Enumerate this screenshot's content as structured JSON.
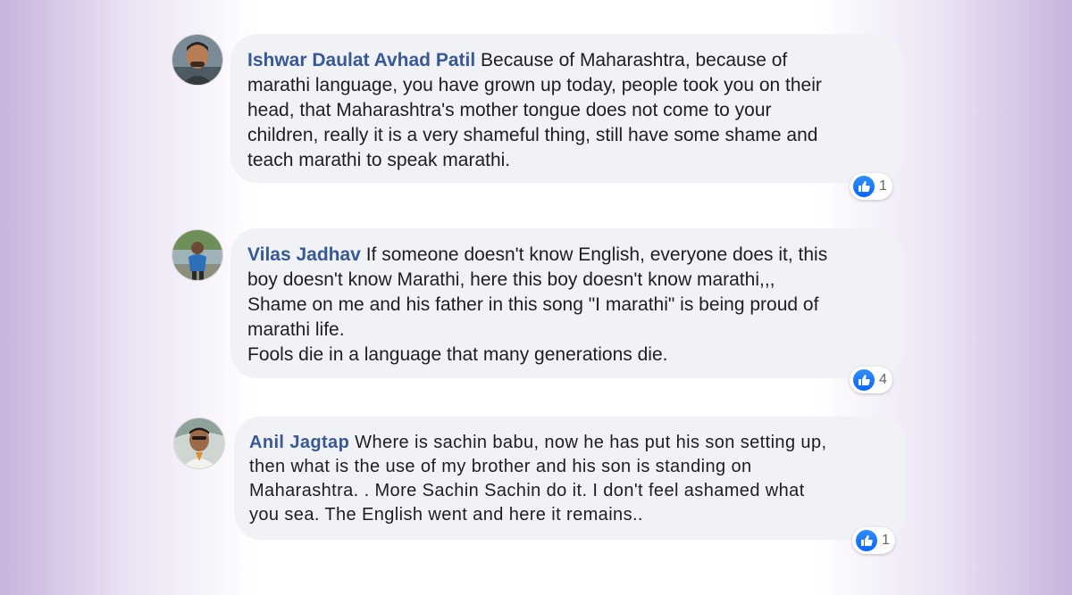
{
  "colors": {
    "author": "#385898",
    "bubble": "#f0f2f5",
    "text": "#1c1e21",
    "like": "#0866ff",
    "count": "#65676b",
    "side_glow": "#c7b3dd"
  },
  "comments": [
    {
      "author": "Ishwar Daulat Avhad Patil",
      "text": "Because of Maharashtra, because of\nmarathi language, you have grown up today, people took you on their\nhead, that Maharashtra's mother tongue does not come to your\nchildren, really it is a very shameful thing, still have some shame and\nteach marathi to speak marathi.",
      "reaction_icon": "like-icon",
      "reaction_count": "1"
    },
    {
      "author": "Vilas Jadhav",
      "text": "If someone doesn't know English, everyone does it, this\nboy doesn't know Marathi, here this boy doesn't know marathi,,,\nShame on me and his father in this song \"I marathi\" is being proud of\nmarathi life.\nFools die in a language that many generations die.",
      "reaction_icon": "like-icon",
      "reaction_count": "4"
    },
    {
      "author": "Anil Jagtap",
      "text": "Where is sachin babu, now he has put his son setting up,\nthen what is the use of my brother and his son is standing on\nMaharashtra. . More Sachin Sachin do it. I don't feel ashamed what\nyou sea. The English went and here it remains..",
      "reaction_icon": "like-icon",
      "reaction_count": "1"
    }
  ]
}
